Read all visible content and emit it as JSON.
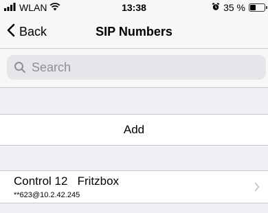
{
  "statusbar": {
    "carrier": "WLAN",
    "time": "13:38",
    "battery_text": "35 %",
    "battery_level": 0.35
  },
  "navbar": {
    "back_label": "Back",
    "title": "SIP Numbers"
  },
  "search": {
    "placeholder": "Search"
  },
  "add_cell": {
    "label": "Add"
  },
  "contacts": [
    {
      "name": "Control 12   Fritzbox",
      "address": "**623@10.2.42.245"
    }
  ],
  "icons": {
    "signal": "signal-bars-icon",
    "wifi": "wifi-icon",
    "alarm": "alarm-icon",
    "battery": "battery-icon",
    "back": "chevron-left-icon",
    "search": "magnifier-icon",
    "disclosure": "chevron-right-icon"
  },
  "colors": {
    "background": "#efeff4",
    "bar": "#f7f7f7",
    "separator": "#c8c7cc",
    "placeholder": "#8e8e93",
    "chevron": "#c7c7cc"
  }
}
